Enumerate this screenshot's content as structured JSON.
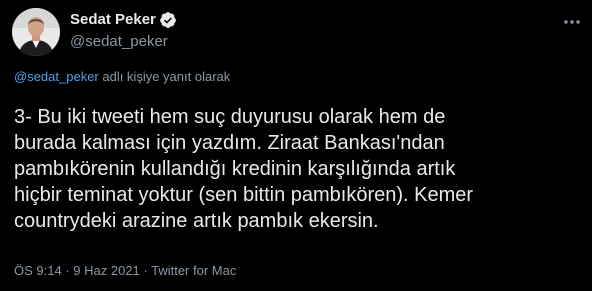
{
  "author": {
    "display_name": "Sedat Peker",
    "handle": "@sedat_peker"
  },
  "reply_context": {
    "mention": "@sedat_peker",
    "suffix": " adlı kişiye yanıt olarak"
  },
  "tweet": {
    "lines": [
      "3- Bu iki tweeti hem suç duyurusu olarak hem de",
      "burada kalması için yazdım. Ziraat Bankası'ndan",
      "pambıkörenin kullandığı kredinin karşılığında artık",
      "hiçbir teminat yoktur (sen bittin pambıkören). Kemer",
      "countrydeki arazine artık pambık ekersin."
    ]
  },
  "meta": {
    "time": "ÖS 9:14",
    "separator": " · ",
    "date": "9 Haz 2021",
    "source": "Twitter for Mac"
  },
  "icons": {
    "verified": "verified-badge-icon",
    "more": "more-options-icon"
  },
  "colors": {
    "background": "#000000",
    "text": "#e7e9ea",
    "secondary": "#8b98a5",
    "link": "#4aa3e8",
    "verified": "#e7e9ea"
  }
}
